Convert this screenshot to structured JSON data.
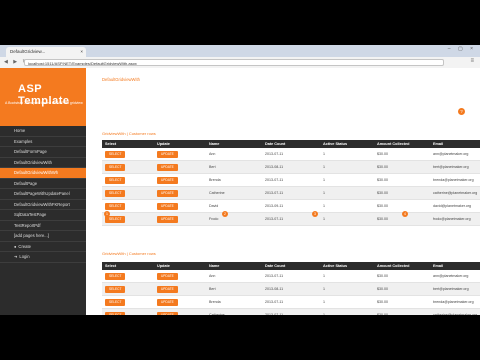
{
  "browser": {
    "tab_title": "DefaultGridview...",
    "tab_close": "×",
    "window_controls": "– ▢ ×",
    "nav_buttons": "◀ ▶ ↻",
    "url": "localhost:1511/ASP.NET/Examples/DefaultGridviewWith.aspx",
    "menu_icon": "≡"
  },
  "sidebar": {
    "logo": "ASP Template",
    "tagline": "A Bootstrap 3 template based on ASP.net gridview",
    "items": [
      {
        "label": "Home"
      },
      {
        "label": "Examples"
      },
      {
        "label": "DefaultFormPage"
      },
      {
        "label": "DefaultGridviewWith"
      },
      {
        "label": "DefaultGridviewWithWh"
      },
      {
        "label": "DefaultPage"
      },
      {
        "label": "DefaultPageWithUpdatePanel"
      },
      {
        "label": "DefaultGridviewWithFKReport"
      },
      {
        "label": "SqlDataTestPage"
      },
      {
        "label": "TestReportPdf"
      },
      {
        "label": "[add pages here...]"
      },
      {
        "label": "Create"
      },
      {
        "label": "Login"
      }
    ]
  },
  "page": {
    "title": "DefaultGridviewWith",
    "help_icon": "?"
  },
  "grid1": {
    "caption": "GridviewWith | Customer rows",
    "headers": [
      "Select",
      "Update",
      "Name",
      "Date Count",
      "Active Status",
      "Amount Collected",
      "Email"
    ],
    "select_label": "SELECT",
    "update_label": "UPDATE",
    "rows": [
      {
        "name": "Ann",
        "date": "2013-07-11",
        "status": "1",
        "amount": "$30.00",
        "email": "ann@planetmaker.org"
      },
      {
        "name": "Bert",
        "date": "2013-08-11",
        "status": "1",
        "amount": "$30.00",
        "email": "bert@planetmaker.org"
      },
      {
        "name": "Brenda",
        "date": "2013-07-11",
        "status": "1",
        "amount": "$30.00",
        "email": "brenda@planetmaker.org"
      },
      {
        "name": "Catherine",
        "date": "2013-07-11",
        "status": "1",
        "amount": "$30.00",
        "email": "catherine@planetmaker.org"
      },
      {
        "name": "David",
        "date": "2013-09-11",
        "status": "1",
        "amount": "$30.00",
        "email": "david@planetmaker.org"
      },
      {
        "name": "Frodo",
        "date": "2013-07-11",
        "status": "1",
        "amount": "$30.00",
        "email": "frodo@planetmaker.org"
      }
    ],
    "pager": [
      "1",
      "2",
      "3",
      "4"
    ]
  },
  "grid2": {
    "caption": "GridviewWith | Customer rows",
    "headers": [
      "Select",
      "Update",
      "Name",
      "Date Count",
      "Active Status",
      "Amount Collected",
      "Email"
    ],
    "select_label": "SELECT",
    "update_label": "UPDATE",
    "rows": [
      {
        "name": "Ann",
        "date": "2013-07-11",
        "status": "1",
        "amount": "$30.00",
        "email": "ann@planetmaker.org"
      },
      {
        "name": "Bert",
        "date": "2013-08-11",
        "status": "1",
        "amount": "$30.00",
        "email": "bert@planetmaker.org"
      },
      {
        "name": "Brenda",
        "date": "2013-07-11",
        "status": "1",
        "amount": "$30.00",
        "email": "brenda@planetmaker.org"
      },
      {
        "name": "Catherine",
        "date": "2013-07-11",
        "status": "1",
        "amount": "$30.00",
        "email": "catherine@planetmaker.org"
      }
    ]
  },
  "colors": {
    "accent": "#f47a1f",
    "sidebar": "#2c2c2c",
    "header": "#2c2c2c"
  }
}
